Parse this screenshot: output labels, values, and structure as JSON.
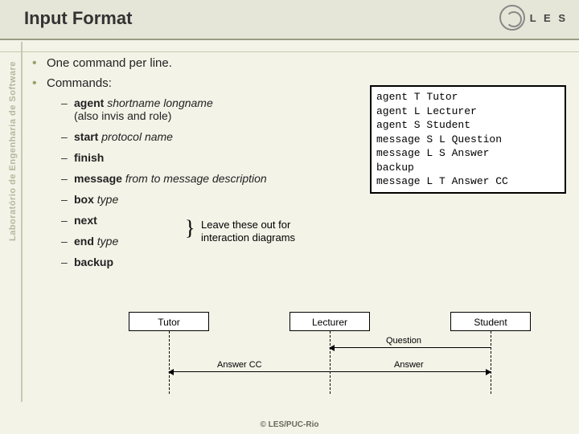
{
  "title": "Input Format",
  "logo_text": "L E S",
  "sidebar": "Laboratório de Engenharia de Software",
  "bullets": {
    "b1": "One command per line.",
    "b2": "Commands:"
  },
  "commands": [
    {
      "cmd": "agent",
      "args": "shortname longname",
      "note": "(also invis and role)"
    },
    {
      "cmd": "start",
      "args": "protocol name"
    },
    {
      "cmd": "finish",
      "args": ""
    },
    {
      "cmd": "message",
      "args": "from to message description"
    },
    {
      "cmd": "box",
      "args": "type"
    },
    {
      "cmd": "next",
      "args": ""
    },
    {
      "cmd": "end",
      "args": "type"
    },
    {
      "cmd": "backup",
      "args": ""
    }
  ],
  "annotation": {
    "line1": "Leave these out for",
    "line2": "interaction diagrams"
  },
  "example_code": "agent T Tutor\nagent L Lecturer\nagent S Student\nmessage S L Question\nmessage L S Answer\nbackup\nmessage L T Answer CC",
  "diagram": {
    "lifelines": [
      "Tutor",
      "Lecturer",
      "Student"
    ],
    "messages": [
      {
        "label": "Question",
        "from": "Student",
        "to": "Lecturer"
      },
      {
        "label": "Answer",
        "from": "Lecturer",
        "to": "Student"
      },
      {
        "label": "Answer CC",
        "from": "Lecturer",
        "to": "Tutor"
      }
    ]
  },
  "footer": "© LES/PUC-Rio"
}
